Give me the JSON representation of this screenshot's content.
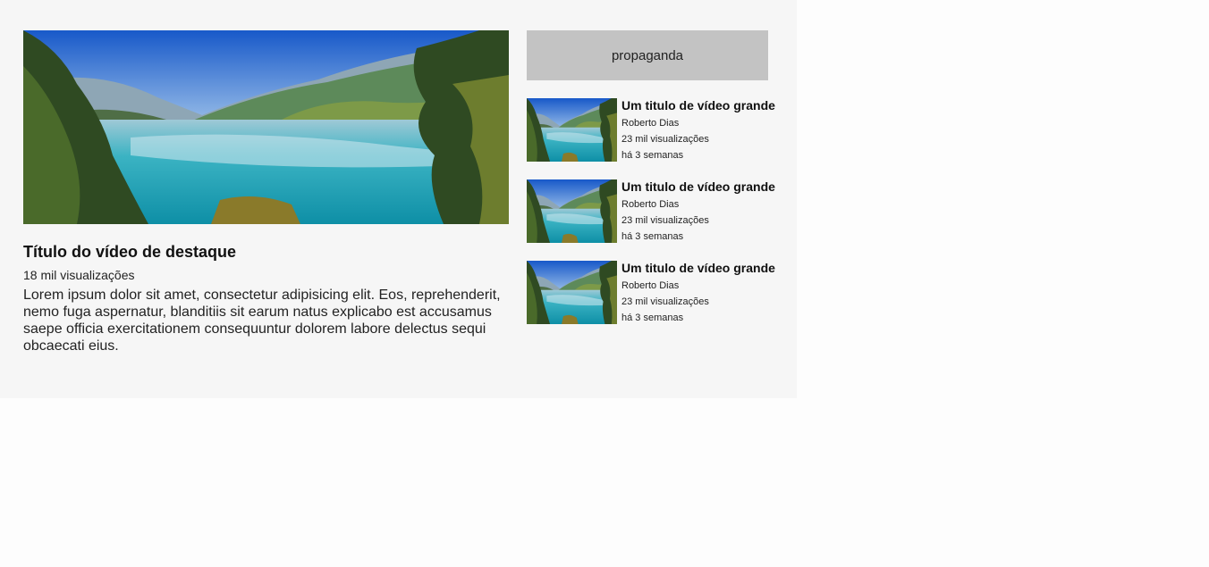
{
  "featured": {
    "title": "Título do vídeo de destaque",
    "views": "18 mil visualizações",
    "description": "Lorem ipsum dolor sit amet, consectetur adipisicing elit. Eos, reprehenderit, nemo fuga aspernatur, blanditiis sit earum natus explicabo est accusamus saepe officia exercitationem consequuntur dolorem labore delectus sequi obcaecati eius."
  },
  "sidebar": {
    "ad_label": "propaganda",
    "videos": [
      {
        "title": "Um titulo de vídeo grande",
        "author": "Roberto Dias",
        "views": "23 mil visualizações",
        "age": "há 3 semanas"
      },
      {
        "title": "Um titulo de vídeo grande",
        "author": "Roberto Dias",
        "views": "23 mil visualizações",
        "age": "há 3 semanas"
      },
      {
        "title": "Um titulo de vídeo grande",
        "author": "Roberto Dias",
        "views": "23 mil visualizações",
        "age": "há 3 semanas"
      }
    ]
  },
  "colors": {
    "background": "#f6f6f6",
    "ad_background": "#c3c3c3",
    "lake": "#1aa6b8",
    "sky": "#1f6fd1"
  }
}
